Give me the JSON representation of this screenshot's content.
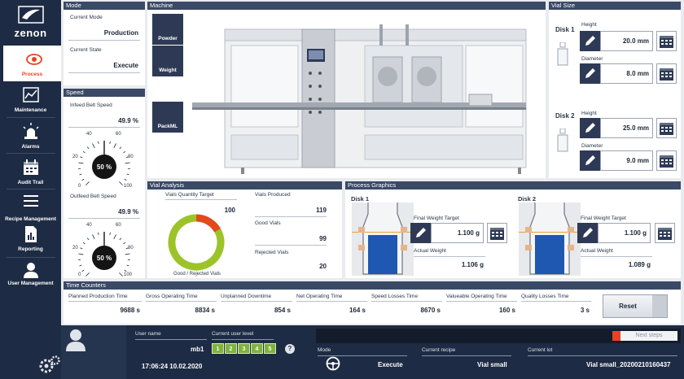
{
  "brand": {
    "name": "zenon"
  },
  "nav": [
    {
      "label": "Process",
      "icon": "eye-icon",
      "active": true
    },
    {
      "label": "Maintenance",
      "icon": "chart-icon"
    },
    {
      "label": "Alarms",
      "icon": "alarm-light-icon"
    },
    {
      "label": "Audit Trail",
      "icon": "calendar-icon"
    },
    {
      "label": "Recipe Management",
      "icon": "list-icon"
    },
    {
      "label": "Reporting",
      "icon": "report-icon"
    },
    {
      "label": "User Management",
      "icon": "user-icon"
    }
  ],
  "mode": {
    "title": "Mode",
    "current_mode_label": "Current Mode",
    "current_mode": "Production",
    "current_state_label": "Current State",
    "current_state": "Execute"
  },
  "speed": {
    "title": "Speed",
    "infeed_label": "Infeed Belt Speed",
    "infeed_value": "49.9 %",
    "infeed_gauge": "50 %",
    "outfeed_label": "Outfeed Belt Speed",
    "outfeed_value": "49.9 %",
    "outfeed_gauge": "50 %",
    "gauge_ticks": [
      "0",
      "20",
      "40",
      "60",
      "80",
      "100"
    ]
  },
  "machine": {
    "title": "Machine",
    "tiles": [
      "Powder",
      "Weight",
      "PackML"
    ]
  },
  "vial_size": {
    "title": "Vial Size",
    "disk1_label": "Disk 1",
    "disk2_label": "Disk 2",
    "height_label": "Height",
    "diameter_label": "Diameter",
    "disk1_height": "20.0 mm",
    "disk1_diameter": "8.0 mm",
    "disk2_height": "25.0 mm",
    "disk2_diameter": "9.0 mm"
  },
  "vial_analysis": {
    "title": "Vial Analysis",
    "quantity_target_label": "Vials Quantity Target",
    "quantity_target": "100",
    "produced_label": "Vials Produced",
    "produced": "119",
    "good_label": "Good Vials",
    "good": "99",
    "rejected_label": "Rejected Vials",
    "rejected": "20",
    "donut_label": "Good / Rejected Vials",
    "good_fraction": 0.832,
    "good_color": "#9cc42a",
    "rejected_color": "#e24a1c"
  },
  "process_graphics": {
    "title": "Process Graphics",
    "disk1_label": "Disk 1",
    "disk2_label": "Disk 2",
    "final_weight_label": "Final Weight Target",
    "actual_weight_label": "Actual Weight",
    "disk1_final": "1.100 g",
    "disk1_actual": "1.106 g",
    "disk2_final": "1.100 g",
    "disk2_actual": "1.089 g"
  },
  "time_counters": {
    "title": "Time Counters",
    "items": [
      {
        "label": "Planned Production Time",
        "value": "9688 s"
      },
      {
        "label": "Gross Operating Time",
        "value": "8834 s"
      },
      {
        "label": "Unplanned Downtime",
        "value": "854 s"
      },
      {
        "label": "Net Operating Time",
        "value": "164 s"
      },
      {
        "label": "Speed Losses Time",
        "value": "8670 s"
      },
      {
        "label": "Valueable Operating Time",
        "value": "160 s"
      },
      {
        "label": "Quality Losses Time",
        "value": "3 s"
      }
    ],
    "reset_label": "Reset"
  },
  "footer": {
    "user_name_label": "User name",
    "user_name": "mb1",
    "user_level_label": "Current user level",
    "levels": [
      "1",
      "2",
      "3",
      "4",
      "5"
    ],
    "help": "?",
    "datetime": "17:06:24 10.02.2020",
    "next_steps": "Next steps",
    "mode_label": "Mode",
    "mode": "Execute",
    "recipe_label": "Current recipe",
    "recipe": "Vial small",
    "lot_label": "Current lot",
    "lot": "Vial small_20200210160437"
  }
}
